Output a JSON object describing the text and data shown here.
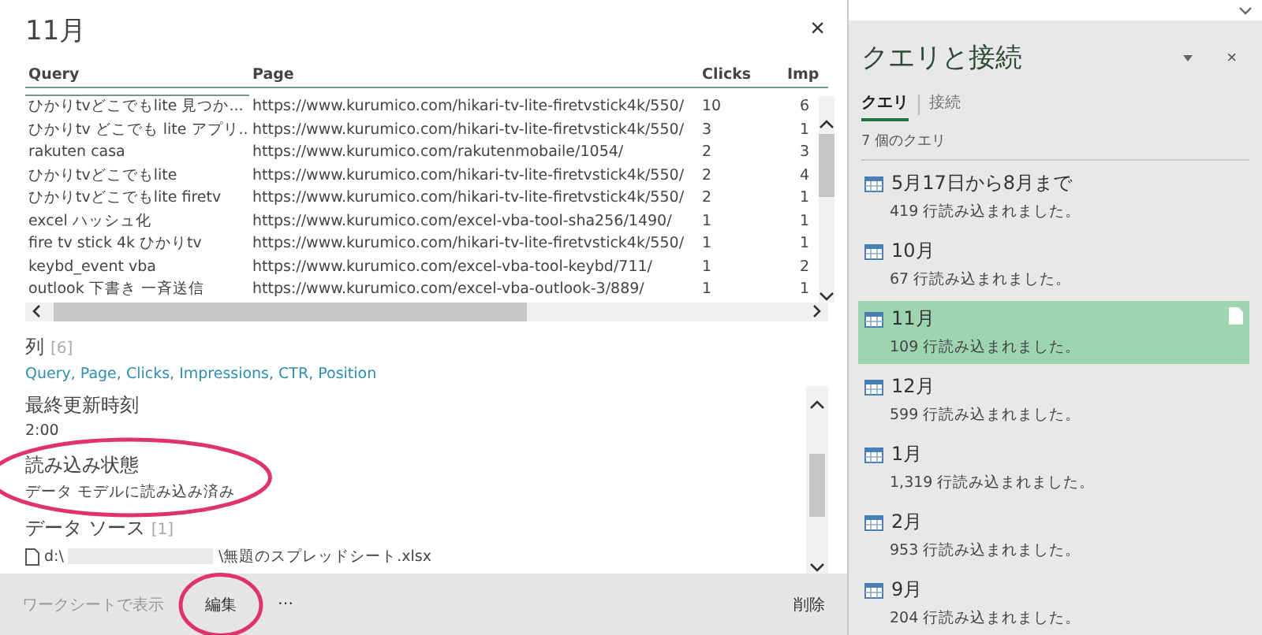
{
  "dialog": {
    "title": "11月",
    "close": "×"
  },
  "table": {
    "columns": [
      "Query",
      "Page",
      "Clicks",
      "Imp"
    ],
    "rows": [
      [
        "ひかりtvどこでもlite 見つか...",
        "https://www.kurumico.com/hikari-tv-lite-firetvstick4k/550/",
        "10",
        "6"
      ],
      [
        "ひかりtv どこでも lite アプリ...",
        "https://www.kurumico.com/hikari-tv-lite-firetvstick4k/550/",
        "3",
        "1"
      ],
      [
        "rakuten casa",
        "https://www.kurumico.com/rakutenmobaile/1054/",
        "2",
        "3"
      ],
      [
        "ひかりtvどこでもlite",
        "https://www.kurumico.com/hikari-tv-lite-firetvstick4k/550/",
        "2",
        "4"
      ],
      [
        "ひかりtvどこでもlite firetv",
        "https://www.kurumico.com/hikari-tv-lite-firetvstick4k/550/",
        "2",
        "1"
      ],
      [
        "excel ハッシュ化",
        "https://www.kurumico.com/excel-vba-tool-sha256/1490/",
        "1",
        "1"
      ],
      [
        "fire tv stick 4k ひかりtv",
        "https://www.kurumico.com/hikari-tv-lite-firetvstick4k/550/",
        "1",
        "1"
      ],
      [
        "keybd_event vba",
        "https://www.kurumico.com/excel-vba-tool-keybd/711/",
        "1",
        "2"
      ],
      [
        "outlook 下書き 一斉送信",
        "https://www.kurumico.com/excel-vba-outlook-3/889/",
        "1",
        "1"
      ]
    ]
  },
  "columns_section": {
    "heading": "列",
    "count": "[6]",
    "separator": ",",
    "links": [
      "Query",
      "Page",
      "Clicks",
      "Impressions",
      "CTR",
      "Position"
    ]
  },
  "details": [
    {
      "kind": "text",
      "heading": "最終更新時刻",
      "value": "2:00"
    },
    {
      "kind": "text",
      "heading": "読み込み状態",
      "value": "データ モデルに読み込み済み",
      "circled": true
    },
    {
      "kind": "file",
      "heading": "データ ソース",
      "count": "[1]",
      "path_start": "d:\\",
      "path_end": "\\無題のスプレッドシート.xlsx"
    }
  ],
  "footer": {
    "buttons": [
      {
        "label": "ワークシートで表示",
        "disabled": true
      },
      {
        "label": "編集",
        "disabled": false,
        "circled": true
      },
      {
        "label": "⋯",
        "disabled": false
      }
    ],
    "delete": "削除"
  },
  "pane": {
    "title": "クエリと接続",
    "close": "×",
    "tabs": [
      {
        "label": "クエリ",
        "selected": true
      },
      {
        "label": "接続",
        "selected": false
      }
    ],
    "count": "7 個のクエリ",
    "queries": [
      {
        "name": "5月17日から8月まで",
        "rows": "419 行読み込まれました。",
        "selected": false
      },
      {
        "name": "10月",
        "rows": "67 行読み込まれました。",
        "selected": false
      },
      {
        "name": "11月",
        "rows": "109 行読み込まれました。",
        "selected": true
      },
      {
        "name": "12月",
        "rows": "599 行読み込まれました。",
        "selected": false
      },
      {
        "name": "1月",
        "rows": "1,319 行読み込まれました。",
        "selected": false
      },
      {
        "name": "2月",
        "rows": "953 行読み込まれました。",
        "selected": false
      },
      {
        "name": "9月",
        "rows": "204 行読み込まれました。",
        "selected": false
      }
    ]
  }
}
